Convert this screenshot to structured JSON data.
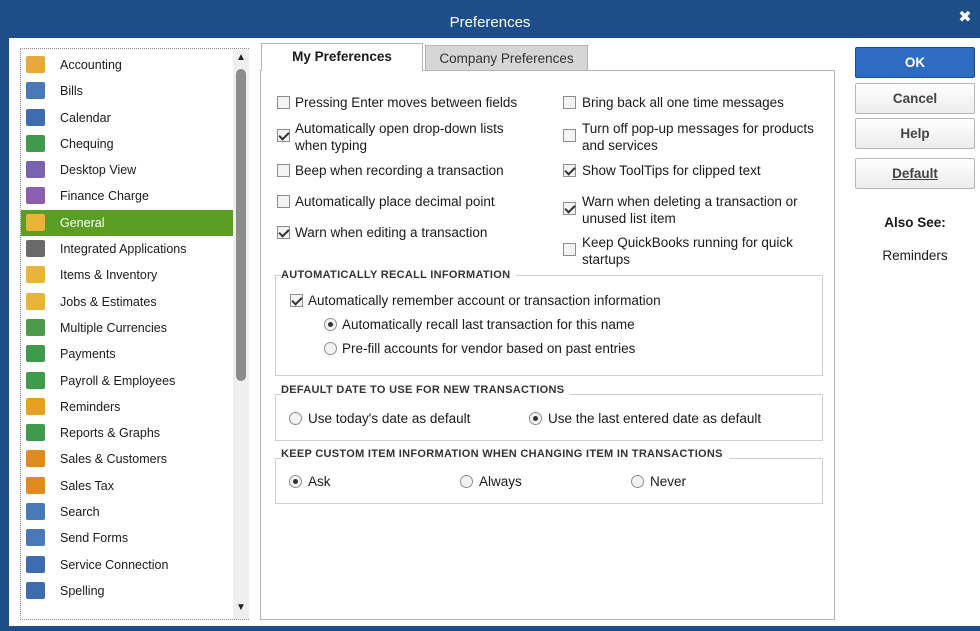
{
  "window": {
    "title": "Preferences",
    "close_glyph": "✖"
  },
  "sidebar": {
    "selected": "General",
    "items": [
      {
        "label": "Accounting",
        "icon": "accounting-icon",
        "color": "#e8a93b"
      },
      {
        "label": "Bills",
        "icon": "bills-icon",
        "color": "#4a79b8"
      },
      {
        "label": "Calendar",
        "icon": "calendar-icon",
        "color": "#3d6cb0"
      },
      {
        "label": "Chequing",
        "icon": "chequing-icon",
        "color": "#3f9a4c"
      },
      {
        "label": "Desktop View",
        "icon": "desktop-view-icon",
        "color": "#7a62b0"
      },
      {
        "label": "Finance Charge",
        "icon": "finance-charge-icon",
        "color": "#8b5fb0"
      },
      {
        "label": "General",
        "icon": "general-icon",
        "color": "#e8b43a"
      },
      {
        "label": "Integrated Applications",
        "icon": "integrated-applications-icon",
        "color": "#6a6a6a"
      },
      {
        "label": "Items & Inventory",
        "icon": "items-inventory-icon",
        "color": "#e8b43a"
      },
      {
        "label": "Jobs & Estimates",
        "icon": "jobs-estimates-icon",
        "color": "#e8b43a"
      },
      {
        "label": "Multiple Currencies",
        "icon": "multiple-currencies-icon",
        "color": "#4d9a4a"
      },
      {
        "label": "Payments",
        "icon": "payments-icon",
        "color": "#3f9a4c"
      },
      {
        "label": "Payroll & Employees",
        "icon": "payroll-employees-icon",
        "color": "#3f9a4c"
      },
      {
        "label": "Reminders",
        "icon": "reminders-icon",
        "color": "#e8a020"
      },
      {
        "label": "Reports & Graphs",
        "icon": "reports-graphs-icon",
        "color": "#3f9a4c"
      },
      {
        "label": "Sales & Customers",
        "icon": "sales-customers-icon",
        "color": "#e08a20"
      },
      {
        "label": "Sales Tax",
        "icon": "sales-tax-icon",
        "color": "#e08a20"
      },
      {
        "label": "Search",
        "icon": "search-icon",
        "color": "#4a79b8"
      },
      {
        "label": "Send Forms",
        "icon": "send-forms-icon",
        "color": "#4a79b8"
      },
      {
        "label": "Service Connection",
        "icon": "service-connection-icon",
        "color": "#3d6cb0"
      },
      {
        "label": "Spelling",
        "icon": "spelling-icon",
        "color": "#3d6cb0"
      }
    ]
  },
  "tabs": {
    "my": "My Preferences",
    "company": "Company Preferences"
  },
  "options": {
    "pressing_enter": {
      "label": "Pressing Enter moves between fields",
      "checked": false
    },
    "auto_open_dropdown": {
      "line1": "Automatically open drop-down lists",
      "line2": "when typing",
      "checked": true
    },
    "beep": {
      "label": "Beep when recording a transaction",
      "checked": false
    },
    "auto_decimal": {
      "label": "Automatically place decimal point",
      "checked": false
    },
    "warn_editing": {
      "label": "Warn when editing a transaction",
      "checked": true
    },
    "bring_back": {
      "label": "Bring back all one time messages",
      "checked": false
    },
    "turn_off_popups": {
      "line1": "Turn off pop-up messages for products",
      "line2": "and services",
      "checked": false
    },
    "show_tooltips": {
      "label": "Show ToolTips for clipped text",
      "checked": true
    },
    "warn_deleting": {
      "line1": "Warn when deleting a transaction or",
      "line2": "unused list item",
      "checked": true
    },
    "keep_running": {
      "line1": "Keep QuickBooks running for quick",
      "line2": "startups",
      "checked": false
    }
  },
  "recall": {
    "title": "AUTOMATICALLY RECALL INFORMATION",
    "remember": {
      "label": "Automatically remember account or transaction information",
      "checked": true
    },
    "recall_last": {
      "label": "Automatically recall last transaction for this name",
      "selected": true
    },
    "prefill": {
      "label": "Pre-fill accounts for vendor based on past entries",
      "selected": false
    }
  },
  "default_date": {
    "title": "DEFAULT DATE TO USE FOR NEW TRANSACTIONS",
    "today": {
      "label": "Use today's date as default",
      "selected": false
    },
    "last_entered": {
      "label": "Use the last entered date as default",
      "selected": true
    }
  },
  "custom_item": {
    "title": "KEEP CUSTOM ITEM INFORMATION WHEN CHANGING ITEM IN TRANSACTIONS",
    "ask": {
      "label": "Ask",
      "selected": true
    },
    "always": {
      "label": "Always",
      "selected": false
    },
    "never": {
      "label": "Never",
      "selected": false
    }
  },
  "buttons": {
    "ok": "OK",
    "cancel": "Cancel",
    "help": "Help",
    "default": "Default"
  },
  "also_see": {
    "title": "Also See:",
    "link": "Reminders"
  },
  "colors": {
    "title_bar": "#1d4e8a",
    "selected_item": "#5a9e24",
    "ok_button": "#2e6cc2"
  }
}
